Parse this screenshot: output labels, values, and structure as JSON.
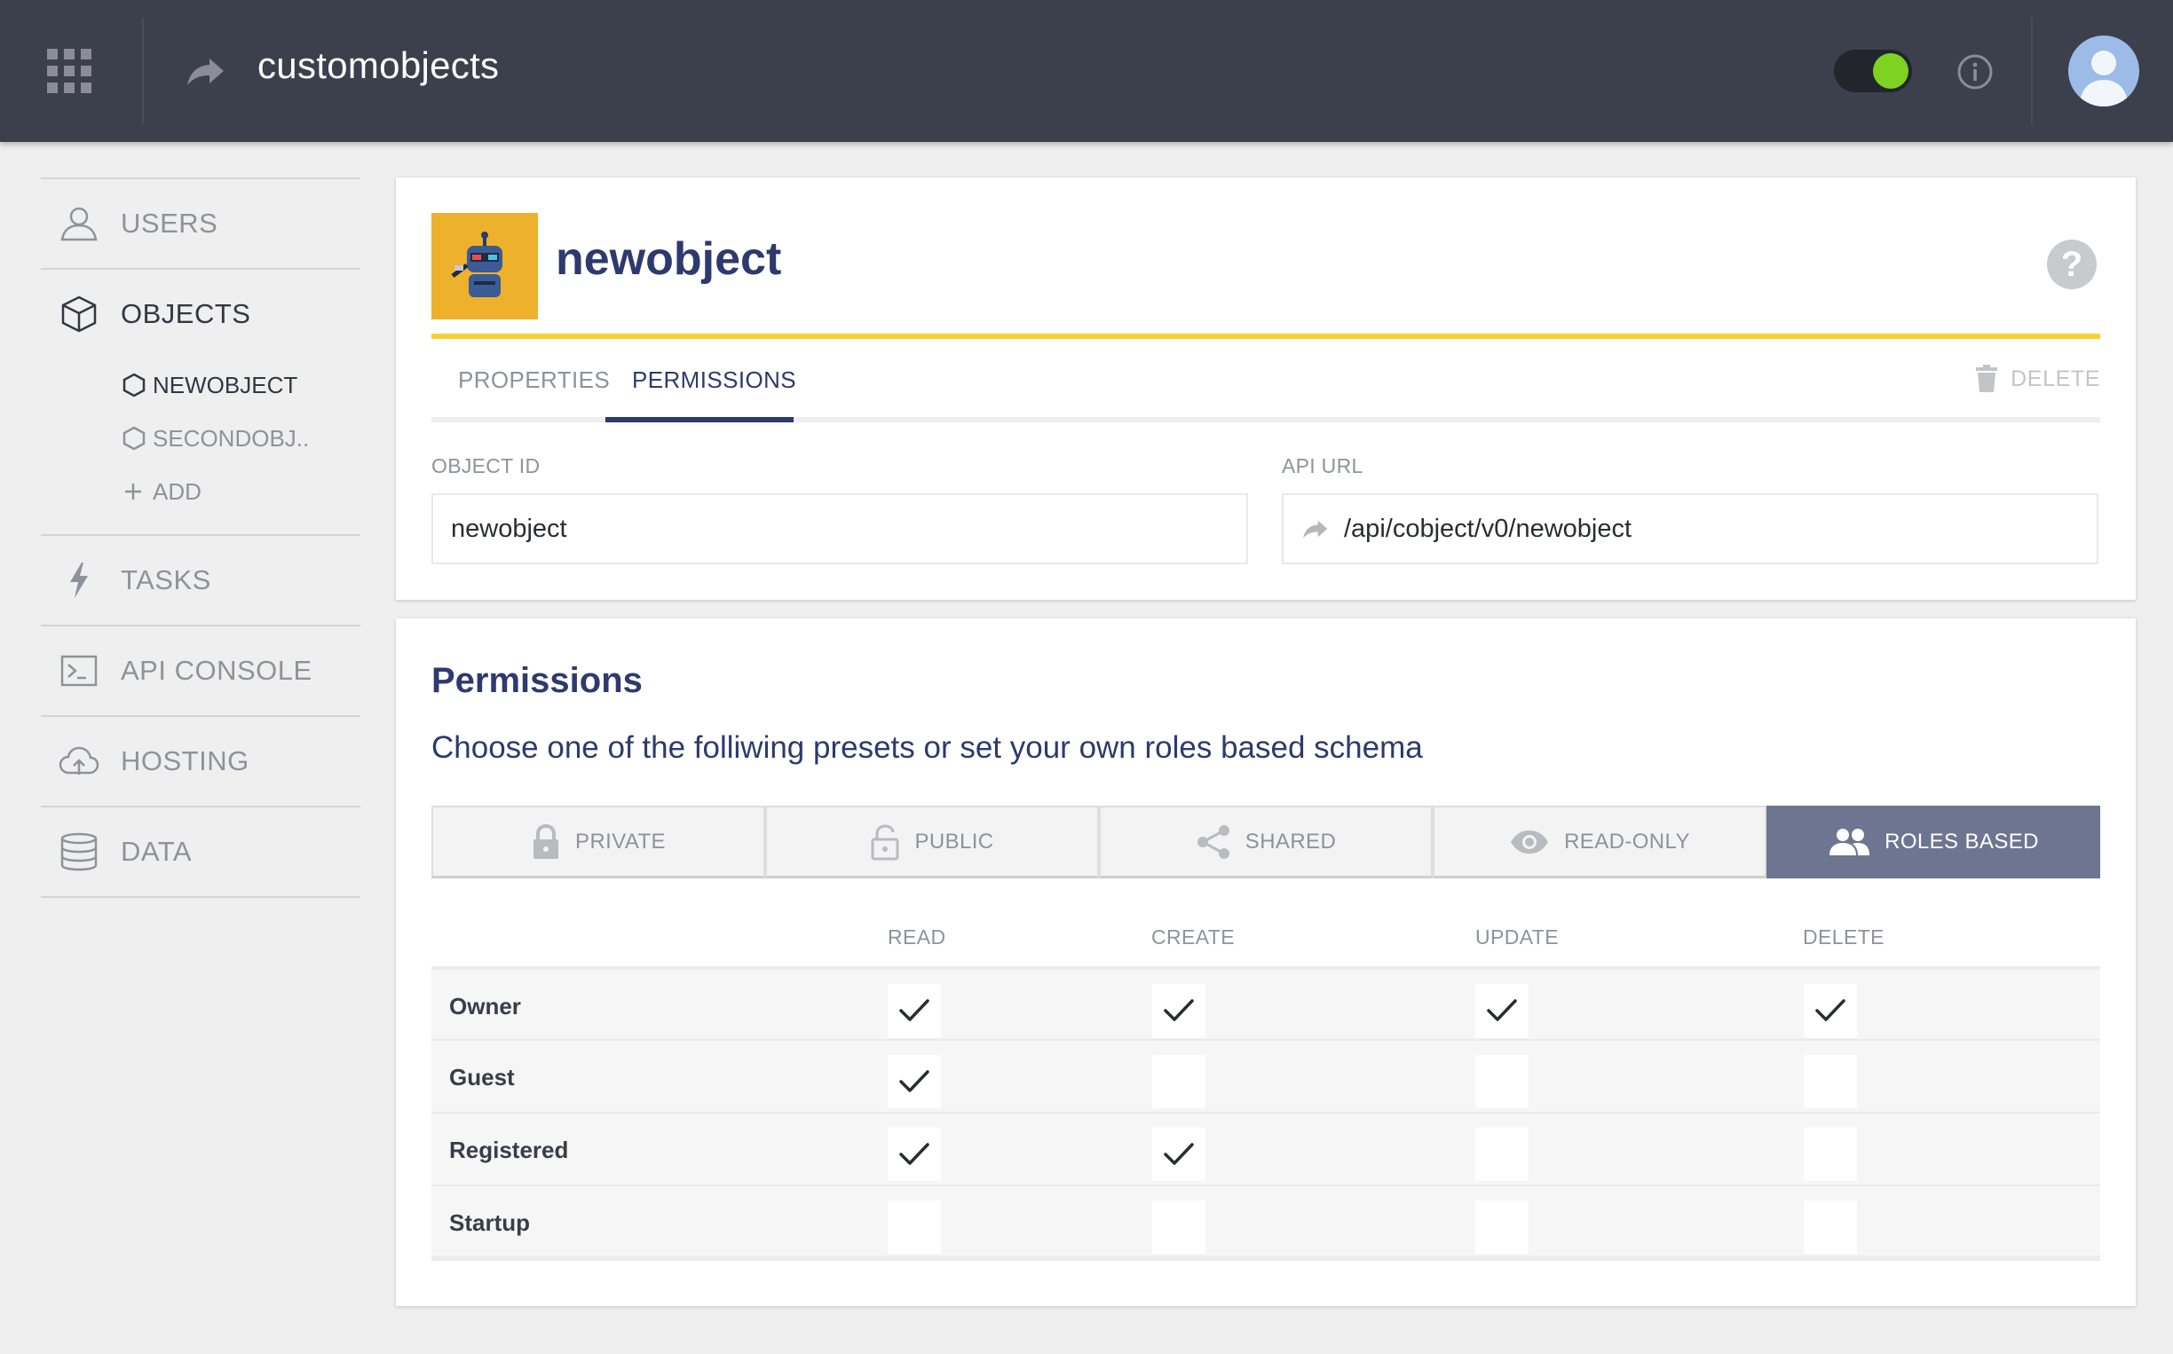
{
  "colors": {
    "topbar": "#3c3f4c",
    "accent": "#2e3a6e",
    "toggle_on": "#7ed321",
    "highlight": "#f8d231",
    "preset_active": "#6e7591"
  },
  "header": {
    "app_name": "customobjects",
    "toggle_on": true
  },
  "sidebar": {
    "items": [
      {
        "label": "USERS",
        "icon": "user-icon"
      },
      {
        "label": "OBJECTS",
        "icon": "cube-icon",
        "active": true
      },
      {
        "label": "TASKS",
        "icon": "bolt-icon"
      },
      {
        "label": "API CONSOLE",
        "icon": "terminal-icon"
      },
      {
        "label": "HOSTING",
        "icon": "cloud-upload-icon"
      },
      {
        "label": "DATA",
        "icon": "database-icon"
      }
    ],
    "objects": [
      {
        "label": "NEWOBJECT",
        "icon": "hexagon-icon",
        "active": true
      },
      {
        "label": "SECONDOBJ..",
        "icon": "hexagon-icon"
      }
    ],
    "add_label": "ADD"
  },
  "object": {
    "title": "newobject",
    "tabs": [
      {
        "label": "PROPERTIES"
      },
      {
        "label": "PERMISSIONS",
        "active": true
      }
    ],
    "delete_label": "DELETE",
    "object_id_label": "OBJECT ID",
    "object_id_value": "newobject",
    "api_url_label": "API URL",
    "api_url_value": "/api/cobject/v0/newobject"
  },
  "permissions": {
    "title": "Permissions",
    "subtitle": "Choose one of the folliwing presets or set your own roles based schema",
    "presets": [
      {
        "label": "PRIVATE",
        "icon": "lock-icon"
      },
      {
        "label": "PUBLIC",
        "icon": "unlock-icon"
      },
      {
        "label": "SHARED",
        "icon": "share-icon"
      },
      {
        "label": "READ-ONLY",
        "icon": "eye-icon"
      },
      {
        "label": "ROLES BASED",
        "icon": "people-icon",
        "active": true
      }
    ],
    "columns": [
      "READ",
      "CREATE",
      "UPDATE",
      "DELETE"
    ],
    "rows": [
      {
        "role": "Owner",
        "values": [
          true,
          true,
          true,
          true
        ]
      },
      {
        "role": "Guest",
        "values": [
          true,
          false,
          false,
          false
        ]
      },
      {
        "role": "Registered",
        "values": [
          true,
          true,
          false,
          false
        ]
      },
      {
        "role": "Startup",
        "values": [
          false,
          false,
          false,
          false
        ]
      }
    ]
  }
}
